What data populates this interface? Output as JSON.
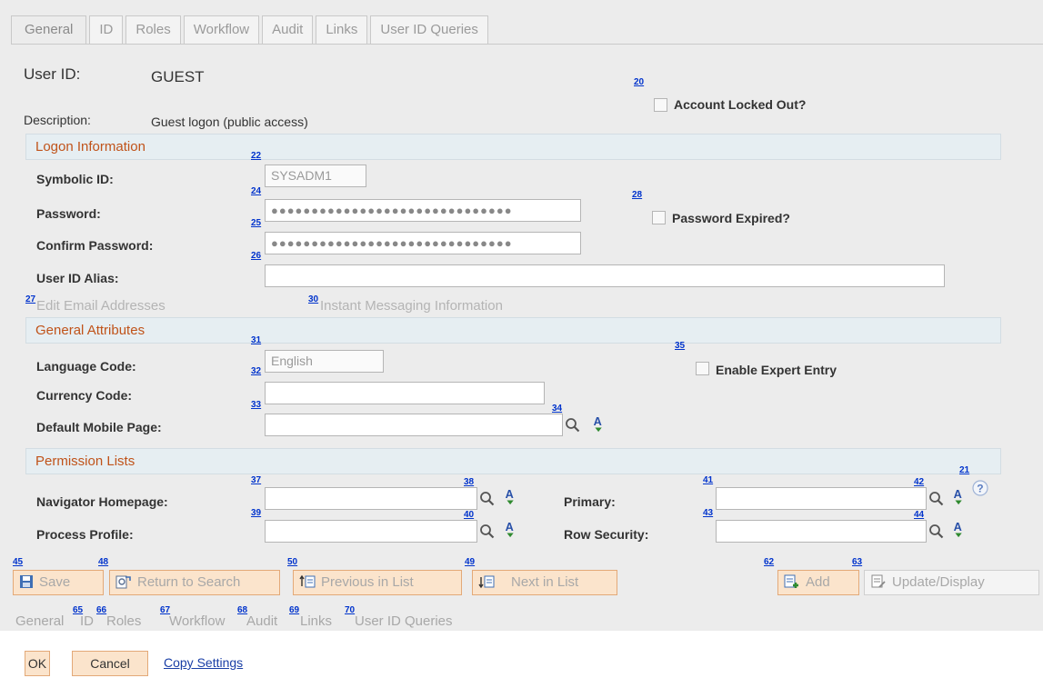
{
  "tabs": [
    "General",
    "ID",
    "Roles",
    "Workflow",
    "Audit",
    "Links",
    "User ID Queries"
  ],
  "user": {
    "user_id_label": "User ID:",
    "user_id_value": "GUEST",
    "description_label": "Description:",
    "description_value": "Guest logon (public access)",
    "account_locked_label": "Account Locked Out?"
  },
  "logon": {
    "section_title": "Logon Information",
    "symbolic_id_label": "Symbolic ID:",
    "symbolic_id_value": "SYSADM1",
    "password_label": "Password:",
    "password_value": "●●●●●●●●●●●●●●●●●●●●●●●●●●●●●●",
    "confirm_password_label": "Confirm Password:",
    "confirm_password_value": "●●●●●●●●●●●●●●●●●●●●●●●●●●●●●●",
    "password_expired_label": "Password Expired?",
    "alias_label": "User ID Alias:",
    "alias_value": "",
    "edit_email_link": "Edit Email Addresses",
    "instant_messaging_link": "Instant Messaging Information"
  },
  "attributes": {
    "section_title": "General Attributes",
    "language_label": "Language Code:",
    "language_value": "English",
    "currency_label": "Currency Code:",
    "currency_value": "",
    "mobile_label": "Default Mobile Page:",
    "mobile_value": "",
    "expert_label": "Enable Expert Entry"
  },
  "permissions": {
    "section_title": "Permission Lists",
    "navigator_label": "Navigator Homepage:",
    "process_label": "Process Profile:",
    "primary_label": "Primary:",
    "row_security_label": "Row Security:"
  },
  "markers": {
    "m20": "20",
    "m21": "21",
    "m22": "22",
    "m24": "24",
    "m25": "25",
    "m26": "26",
    "m27": "27",
    "m28": "28",
    "m30": "30",
    "m31": "31",
    "m32": "32",
    "m33": "33",
    "m34": "34",
    "m35": "35",
    "m37": "37",
    "m38": "38",
    "m39": "39",
    "m40": "40",
    "m41": "41",
    "m42": "42",
    "m43": "43",
    "m44": "44",
    "m45": "45",
    "m48": "48",
    "m49": "49",
    "m50": "50",
    "m62": "62",
    "m63": "63",
    "m65": "65",
    "m66": "66",
    "m67": "67",
    "m68": "68",
    "m69": "69",
    "m70": "70"
  },
  "toolbar": {
    "save": "Save",
    "return_to_search": "Return to Search",
    "previous_in_list": "Previous in List",
    "next_in_list": "Next in List",
    "add": "Add",
    "update_display": "Update/Display"
  },
  "bottom_tabs": [
    "General",
    "ID",
    "Roles",
    "Workflow",
    "Audit",
    "Links",
    "User ID Queries"
  ],
  "footer": {
    "ok": "OK",
    "cancel": "Cancel",
    "copy_settings": "Copy Settings"
  },
  "colors": {
    "section_title": "#c0531a",
    "link": "#1a3fa6",
    "marker": "#0033cc",
    "button_bg": "#fbe4cc"
  },
  "icons": [
    "lookup-icon",
    "prompt-icon",
    "help-icon",
    "save-icon",
    "return-icon",
    "previous-icon",
    "next-icon",
    "add-icon",
    "update-icon"
  ]
}
